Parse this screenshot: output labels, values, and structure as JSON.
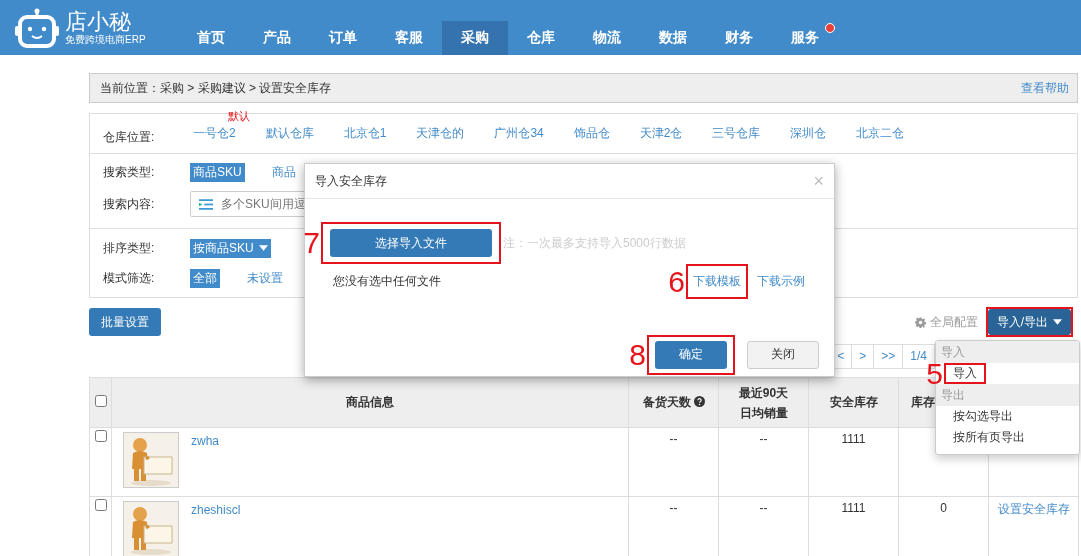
{
  "header": {
    "logo": {
      "name": "店小秘",
      "tagline": "免费跨境电商ERP"
    },
    "nav": [
      {
        "label": "首页",
        "selected": false,
        "notification": false
      },
      {
        "label": "产品",
        "selected": false,
        "notification": false
      },
      {
        "label": "订单",
        "selected": false,
        "notification": false
      },
      {
        "label": "客服",
        "selected": false,
        "notification": false
      },
      {
        "label": "采购",
        "selected": true,
        "notification": false
      },
      {
        "label": "仓库",
        "selected": false,
        "notification": false
      },
      {
        "label": "物流",
        "selected": false,
        "notification": false
      },
      {
        "label": "数据",
        "selected": false,
        "notification": false
      },
      {
        "label": "财务",
        "selected": false,
        "notification": false
      },
      {
        "label": "服务",
        "selected": false,
        "notification": true
      }
    ]
  },
  "breadcrumb": {
    "text": "当前位置：采购 > 采购建议 > 设置安全库存",
    "help_link": "查看帮助"
  },
  "filters": {
    "warehouse": {
      "label": "仓库位置:",
      "options": [
        {
          "label": "一号仓2",
          "tag": "默认"
        },
        {
          "label": "默认仓库"
        },
        {
          "label": "北京仓1"
        },
        {
          "label": "天津仓的"
        },
        {
          "label": "广州仓34"
        },
        {
          "label": "饰品仓"
        },
        {
          "label": "天津2仓"
        },
        {
          "label": "三号仓库"
        },
        {
          "label": "深圳仓"
        },
        {
          "label": "北京二仓"
        }
      ]
    },
    "search_type": {
      "label": "搜索类型:",
      "options": [
        {
          "label": "商品SKU",
          "selected": true
        },
        {
          "label": "商品",
          "selected": false
        }
      ]
    },
    "search_content": {
      "label": "搜索内容:",
      "placeholder": "多个SKU间用逗"
    },
    "sort_type": {
      "label": "排序类型:",
      "options": [
        {
          "label": "按商品SKU",
          "selected": true
        }
      ]
    },
    "mode_filter": {
      "label": "模式筛选:",
      "options": [
        {
          "label": "全部",
          "selected": true
        },
        {
          "label": "未设置",
          "selected": false
        }
      ]
    }
  },
  "toolbar": {
    "batch_button": "批量设置",
    "settings_link": "全局配置",
    "import_export_button": {
      "label": "导入/导出",
      "highlighted": true
    }
  },
  "pagination": [
    "<",
    ">",
    ">>",
    "1/4"
  ],
  "table": {
    "select_all_checked": false,
    "columns": [
      {
        "label": "商品信息"
      },
      {
        "label": "备货天数",
        "help": true
      },
      {
        "lines": [
          "最近90天",
          "日均销量"
        ]
      },
      {
        "label": "安全库存"
      },
      {
        "label": "库存"
      }
    ],
    "rows": [
      {
        "checked": false,
        "sku": "zwha",
        "stock_days": "--",
        "avg_sales": "--",
        "safety_stock": "1111"
      },
      {
        "checked": false,
        "sku": "zheshiscl",
        "stock_days": "--",
        "avg_sales": "--",
        "safety_stock": "1111",
        "stock": "0",
        "action": "设置安全库存"
      }
    ]
  },
  "modal": {
    "title": "导入安全库存",
    "close": "×",
    "choose_button": {
      "label": "选择导入文件",
      "highlighted": true,
      "step": "7"
    },
    "note": "注：一次最多支持导入5000行数据",
    "status": "您没有选中任何文件",
    "links": [
      {
        "label": "下载模板",
        "highlighted": true,
        "step": "6"
      },
      {
        "label": "下载示例",
        "highlighted": false
      }
    ],
    "buttons": [
      {
        "label": "确定",
        "kind": "primary",
        "highlighted": true,
        "step": "8"
      },
      {
        "label": "关闭",
        "kind": "default",
        "highlighted": false
      }
    ]
  },
  "dropdown_menu": {
    "groups": [
      {
        "header": "导入",
        "items": [
          {
            "label": "导入",
            "highlighted": true,
            "step": "5"
          }
        ]
      },
      {
        "header": "导出",
        "items": [
          {
            "label": "按勾选导出",
            "highlighted": false
          },
          {
            "label": "按所有页导出",
            "highlighted": false
          }
        ]
      }
    ]
  }
}
